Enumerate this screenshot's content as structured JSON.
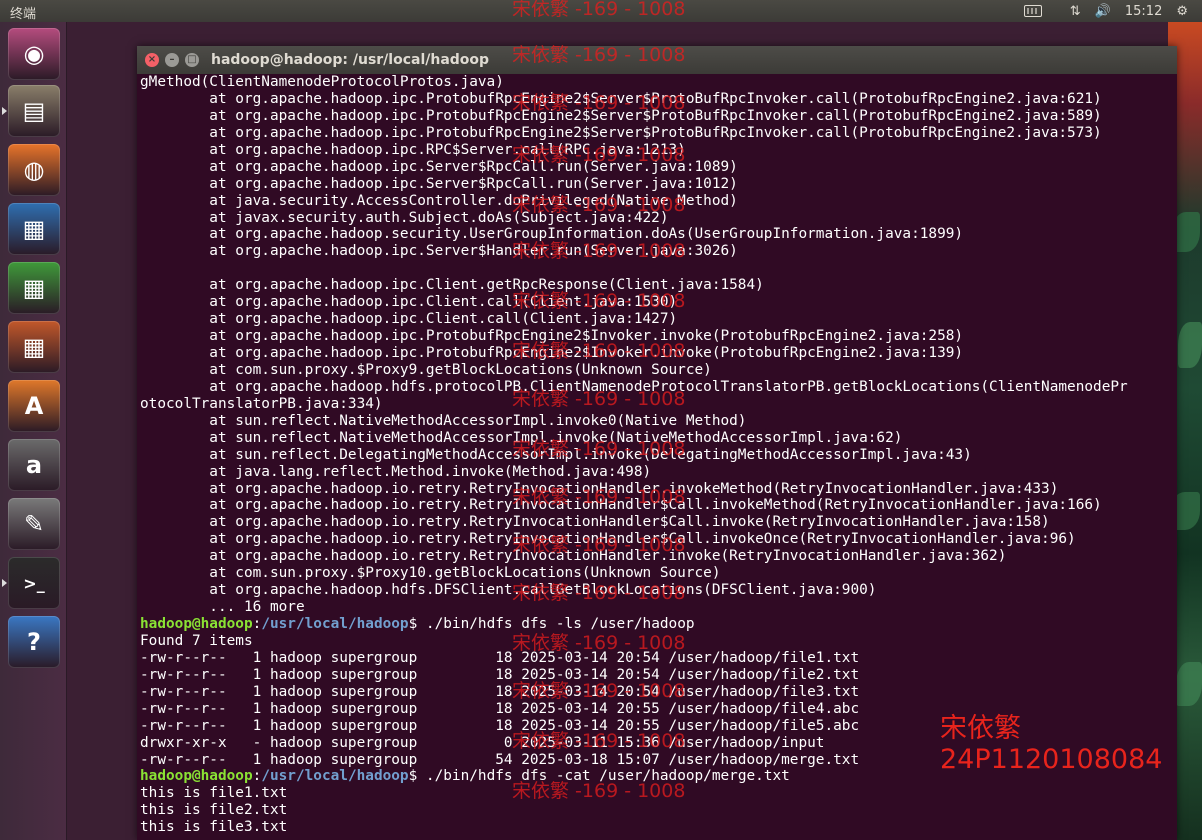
{
  "top_panel": {
    "title": "终端",
    "clock": "15:12",
    "icons": [
      "keyboard-icon",
      "network-icon",
      "volume-icon",
      "gear-icon"
    ]
  },
  "launcher": {
    "items": [
      {
        "name": "ubuntu-dash",
        "color": "#b54c7e",
        "glyph": "◉"
      },
      {
        "name": "files",
        "color": "#8a7f6a",
        "glyph": "▤"
      },
      {
        "name": "firefox",
        "color": "#e8742a",
        "glyph": "◍"
      },
      {
        "name": "libreoffice-writer",
        "color": "#2f6fb1",
        "glyph": "▦"
      },
      {
        "name": "libreoffice-calc",
        "color": "#3f9a3a",
        "glyph": "▦"
      },
      {
        "name": "libreoffice-impress",
        "color": "#c2582a",
        "glyph": "▦"
      },
      {
        "name": "software-center",
        "color": "#e0782a",
        "glyph": "A"
      },
      {
        "name": "amazon",
        "color": "#6b6b6b",
        "glyph": "a"
      },
      {
        "name": "system-settings",
        "color": "#7a7a7a",
        "glyph": "✎"
      },
      {
        "name": "terminal",
        "color": "#2b2b2b",
        "glyph": ">_"
      },
      {
        "name": "help",
        "color": "#3a78c4",
        "glyph": "?"
      }
    ]
  },
  "window": {
    "title": "hadoop@hadoop: /usr/local/hadoop"
  },
  "terminal": {
    "lines": [
      {
        "t": "gMethod(ClientNamenodeProtocolProtos.java)"
      },
      {
        "t": "        at org.apache.hadoop.ipc.ProtobufRpcEngine2$Server$ProtoBufRpcInvoker.call(ProtobufRpcEngine2.java:621)"
      },
      {
        "t": "        at org.apache.hadoop.ipc.ProtobufRpcEngine2$Server$ProtoBufRpcInvoker.call(ProtobufRpcEngine2.java:589)"
      },
      {
        "t": "        at org.apache.hadoop.ipc.ProtobufRpcEngine2$Server$ProtoBufRpcInvoker.call(ProtobufRpcEngine2.java:573)"
      },
      {
        "t": "        at org.apache.hadoop.ipc.RPC$Server.call(RPC.java:1213)"
      },
      {
        "t": "        at org.apache.hadoop.ipc.Server$RpcCall.run(Server.java:1089)"
      },
      {
        "t": "        at org.apache.hadoop.ipc.Server$RpcCall.run(Server.java:1012)"
      },
      {
        "t": "        at java.security.AccessController.doPrivileged(Native Method)"
      },
      {
        "t": "        at javax.security.auth.Subject.doAs(Subject.java:422)"
      },
      {
        "t": "        at org.apache.hadoop.security.UserGroupInformation.doAs(UserGroupInformation.java:1899)"
      },
      {
        "t": "        at org.apache.hadoop.ipc.Server$Handler.run(Server.java:3026)"
      },
      {
        "t": ""
      },
      {
        "t": "        at org.apache.hadoop.ipc.Client.getRpcResponse(Client.java:1584)"
      },
      {
        "t": "        at org.apache.hadoop.ipc.Client.call(Client.java:1530)"
      },
      {
        "t": "        at org.apache.hadoop.ipc.Client.call(Client.java:1427)"
      },
      {
        "t": "        at org.apache.hadoop.ipc.ProtobufRpcEngine2$Invoker.invoke(ProtobufRpcEngine2.java:258)"
      },
      {
        "t": "        at org.apache.hadoop.ipc.ProtobufRpcEngine2$Invoker.invoke(ProtobufRpcEngine2.java:139)"
      },
      {
        "t": "        at com.sun.proxy.$Proxy9.getBlockLocations(Unknown Source)"
      },
      {
        "t": "        at org.apache.hadoop.hdfs.protocolPB.ClientNamenodeProtocolTranslatorPB.getBlockLocations(ClientNamenodePr"
      },
      {
        "t": "otocolTranslatorPB.java:334)"
      },
      {
        "t": "        at sun.reflect.NativeMethodAccessorImpl.invoke0(Native Method)"
      },
      {
        "t": "        at sun.reflect.NativeMethodAccessorImpl.invoke(NativeMethodAccessorImpl.java:62)"
      },
      {
        "t": "        at sun.reflect.DelegatingMethodAccessorImpl.invoke(DelegatingMethodAccessorImpl.java:43)"
      },
      {
        "t": "        at java.lang.reflect.Method.invoke(Method.java:498)"
      },
      {
        "t": "        at org.apache.hadoop.io.retry.RetryInvocationHandler.invokeMethod(RetryInvocationHandler.java:433)"
      },
      {
        "t": "        at org.apache.hadoop.io.retry.RetryInvocationHandler$Call.invokeMethod(RetryInvocationHandler.java:166)"
      },
      {
        "t": "        at org.apache.hadoop.io.retry.RetryInvocationHandler$Call.invoke(RetryInvocationHandler.java:158)"
      },
      {
        "t": "        at org.apache.hadoop.io.retry.RetryInvocationHandler$Call.invokeOnce(RetryInvocationHandler.java:96)"
      },
      {
        "t": "        at org.apache.hadoop.io.retry.RetryInvocationHandler.invoke(RetryInvocationHandler.java:362)"
      },
      {
        "t": "        at com.sun.proxy.$Proxy10.getBlockLocations(Unknown Source)"
      },
      {
        "t": "        at org.apache.hadoop.hdfs.DFSClient.callGetBlockLocations(DFSClient.java:900)"
      },
      {
        "t": "        ... 16 more"
      },
      {
        "user": "hadoop@hadoop",
        "sep": ":",
        "path": "/usr/local/hadoop",
        "cmd": "$ ./bin/hdfs dfs -ls /user/hadoop"
      },
      {
        "t": "Found 7 items"
      },
      {
        "t": "-rw-r--r--   1 hadoop supergroup         18 2025-03-14 20:54 /user/hadoop/file1.txt"
      },
      {
        "t": "-rw-r--r--   1 hadoop supergroup         18 2025-03-14 20:54 /user/hadoop/file2.txt"
      },
      {
        "t": "-rw-r--r--   1 hadoop supergroup         18 2025-03-14 20:54 /user/hadoop/file3.txt"
      },
      {
        "t": "-rw-r--r--   1 hadoop supergroup         18 2025-03-14 20:55 /user/hadoop/file4.abc"
      },
      {
        "t": "-rw-r--r--   1 hadoop supergroup         18 2025-03-14 20:55 /user/hadoop/file5.abc"
      },
      {
        "t": "drwxr-xr-x   - hadoop supergroup          0 2025-03-11 15:36 /user/hadoop/input"
      },
      {
        "t": "-rw-r--r--   1 hadoop supergroup         54 2025-03-18 15:07 /user/hadoop/merge.txt"
      },
      {
        "user": "hadoop@hadoop",
        "sep": ":",
        "path": "/usr/local/hadoop",
        "cmd": "$ ./bin/hdfs dfs -cat /user/hadoop/merge.txt"
      },
      {
        "t": "this is file1.txt"
      },
      {
        "t": "this is file2.txt"
      },
      {
        "t": "this is file3.txt"
      }
    ]
  },
  "watermark": {
    "repeat_text": "宋依繁 -169 - 1008",
    "name": "宋依繁",
    "student_id": "24P1120108084",
    "color": "#e8241c"
  }
}
